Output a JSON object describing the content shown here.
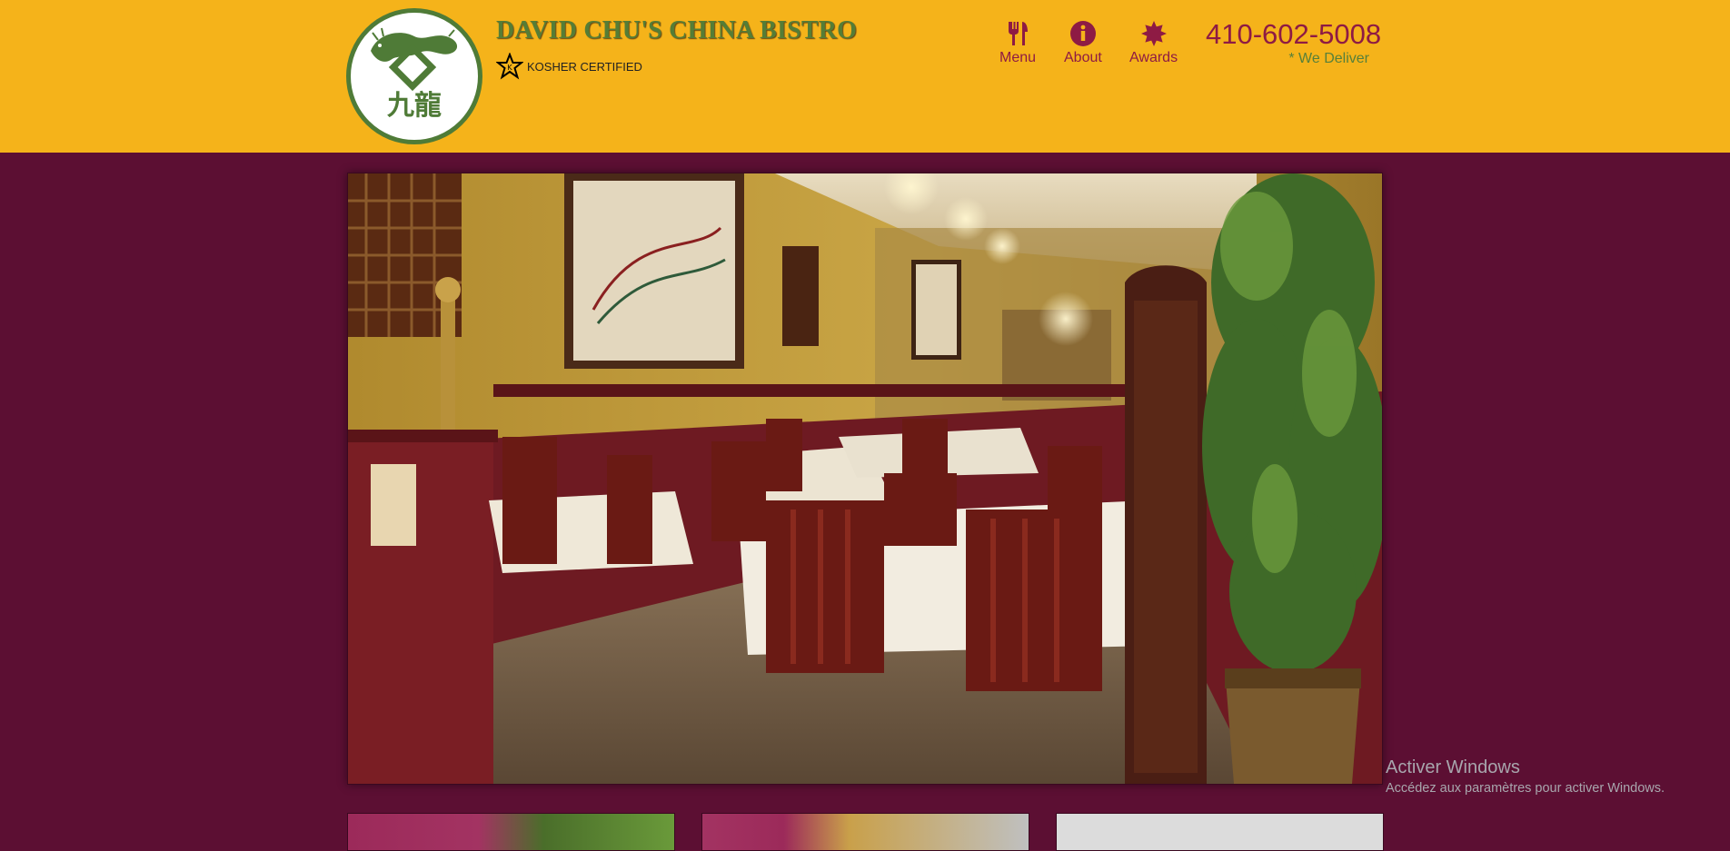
{
  "header": {
    "site_title": "DAVID CHU'S CHINA BISTRO",
    "kosher_label": "KOSHER CERTIFIED",
    "logo_chars": "九龍",
    "phone": "410-602-5008",
    "delivery_note": "* We Deliver"
  },
  "nav": [
    {
      "label": "Menu",
      "icon": "fork-knife-icon"
    },
    {
      "label": "About",
      "icon": "info-icon"
    },
    {
      "label": "Awards",
      "icon": "badge-icon"
    }
  ],
  "hero": {
    "description_icon": "restaurant-dining-room-photo"
  },
  "cards": [
    {
      "icon": "food-photo-vegetables"
    },
    {
      "icon": "food-photo-dumplings"
    },
    {
      "icon": "blank-card"
    }
  ],
  "os_watermark": {
    "title": "Activer Windows",
    "subtitle": "Accédez aux paramètres pour activer Windows."
  },
  "colors": {
    "header_bg": "#f5b31a",
    "page_bg": "#5c0f33",
    "accent": "#8e1b44",
    "green": "#557d36"
  }
}
